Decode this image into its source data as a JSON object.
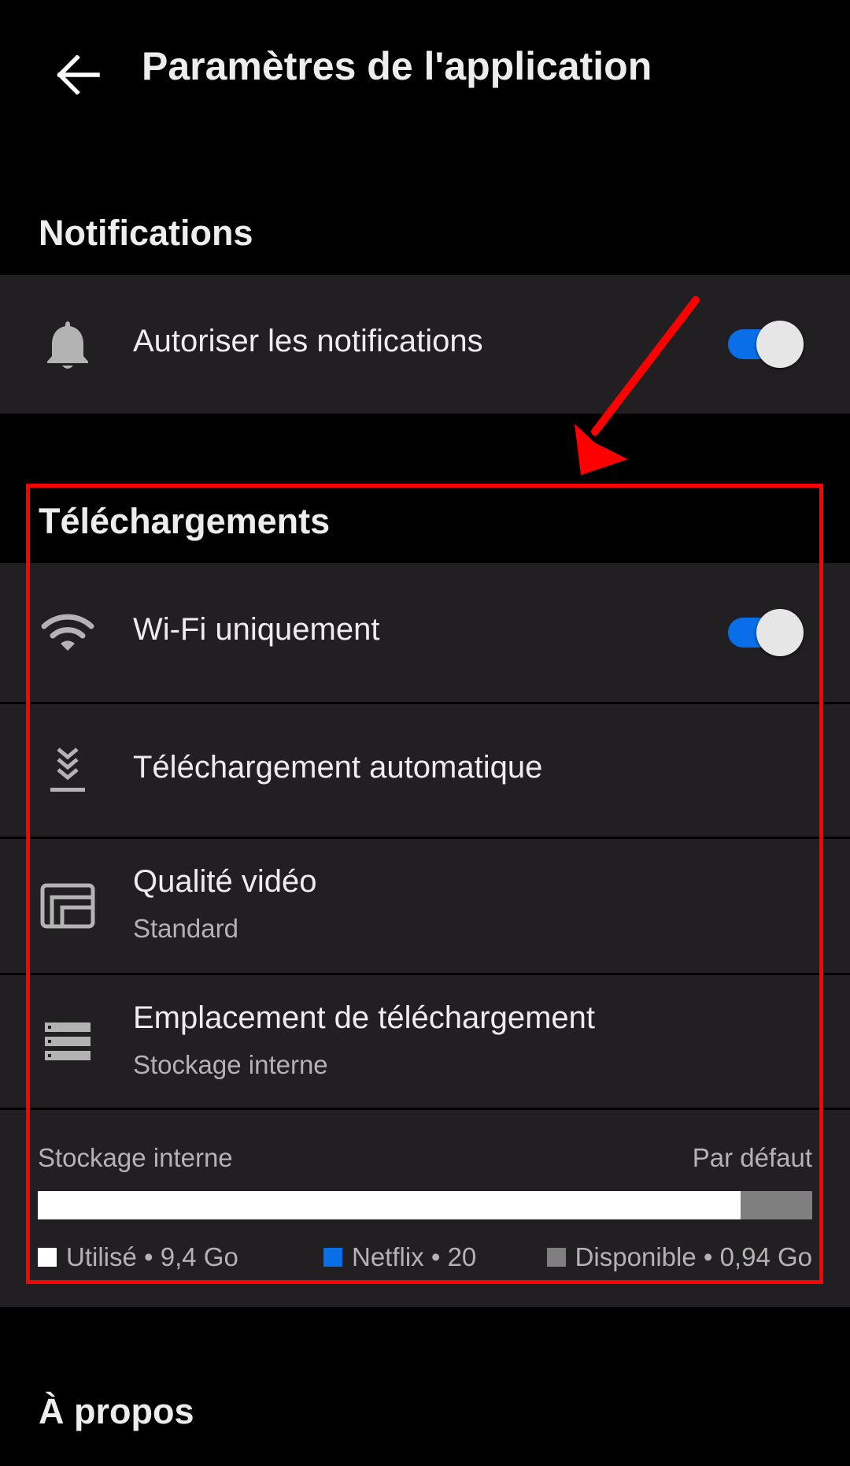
{
  "header": {
    "back_label": "←",
    "title": "Paramètres de l'application"
  },
  "notifications": {
    "title": "Notifications",
    "allow": {
      "label": "Autoriser les notifications",
      "icon": "bell-icon",
      "enabled": true
    }
  },
  "downloads": {
    "title": "Téléchargements",
    "wifi_only": {
      "label": "Wi-Fi uniquement",
      "icon": "wifi-icon",
      "enabled": true
    },
    "auto_download": {
      "label": "Téléchargement automatique",
      "icon": "smart-download-icon"
    },
    "video_quality": {
      "label": "Qualité vidéo",
      "value": "Standard",
      "icon": "video-quality-icon"
    },
    "download_location": {
      "label": "Emplacement de téléchargement",
      "value": "Stockage interne",
      "icon": "storage-icon"
    },
    "storage": {
      "name": "Stockage interne",
      "default_label": "Par défaut",
      "used_fraction": 0.908,
      "netflix_fraction": 0.0,
      "legend": {
        "used": "Utilisé • 9,4  Go",
        "netflix": "Netflix • 20",
        "available": "Disponible • 0,94  Go"
      }
    }
  },
  "about": {
    "title": "À propos"
  },
  "colors": {
    "background": "#000000",
    "row_background": "#211f21",
    "accent_blue": "#0a6ee8",
    "annotation_red": "#ff0000",
    "storage_available": "#7f7f7f"
  }
}
